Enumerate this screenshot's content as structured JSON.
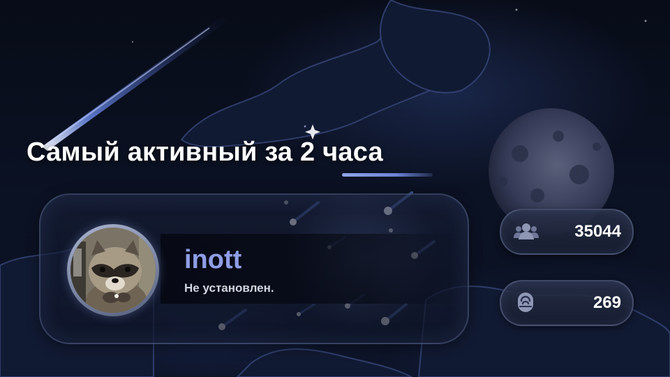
{
  "banner": {
    "title": "Самый активный за 2 часа"
  },
  "top_user": {
    "username": "inott",
    "status": "Не установлен.",
    "avatar_icon": "raccoon-avatar"
  },
  "stats": {
    "members": {
      "icon": "users-icon",
      "value": "35044"
    },
    "voice": {
      "icon": "microphone-icon",
      "value": "269"
    }
  },
  "colors": {
    "username": "#8f9ee6",
    "accent_underline": "#8fa6e8",
    "background": "#070b16"
  }
}
